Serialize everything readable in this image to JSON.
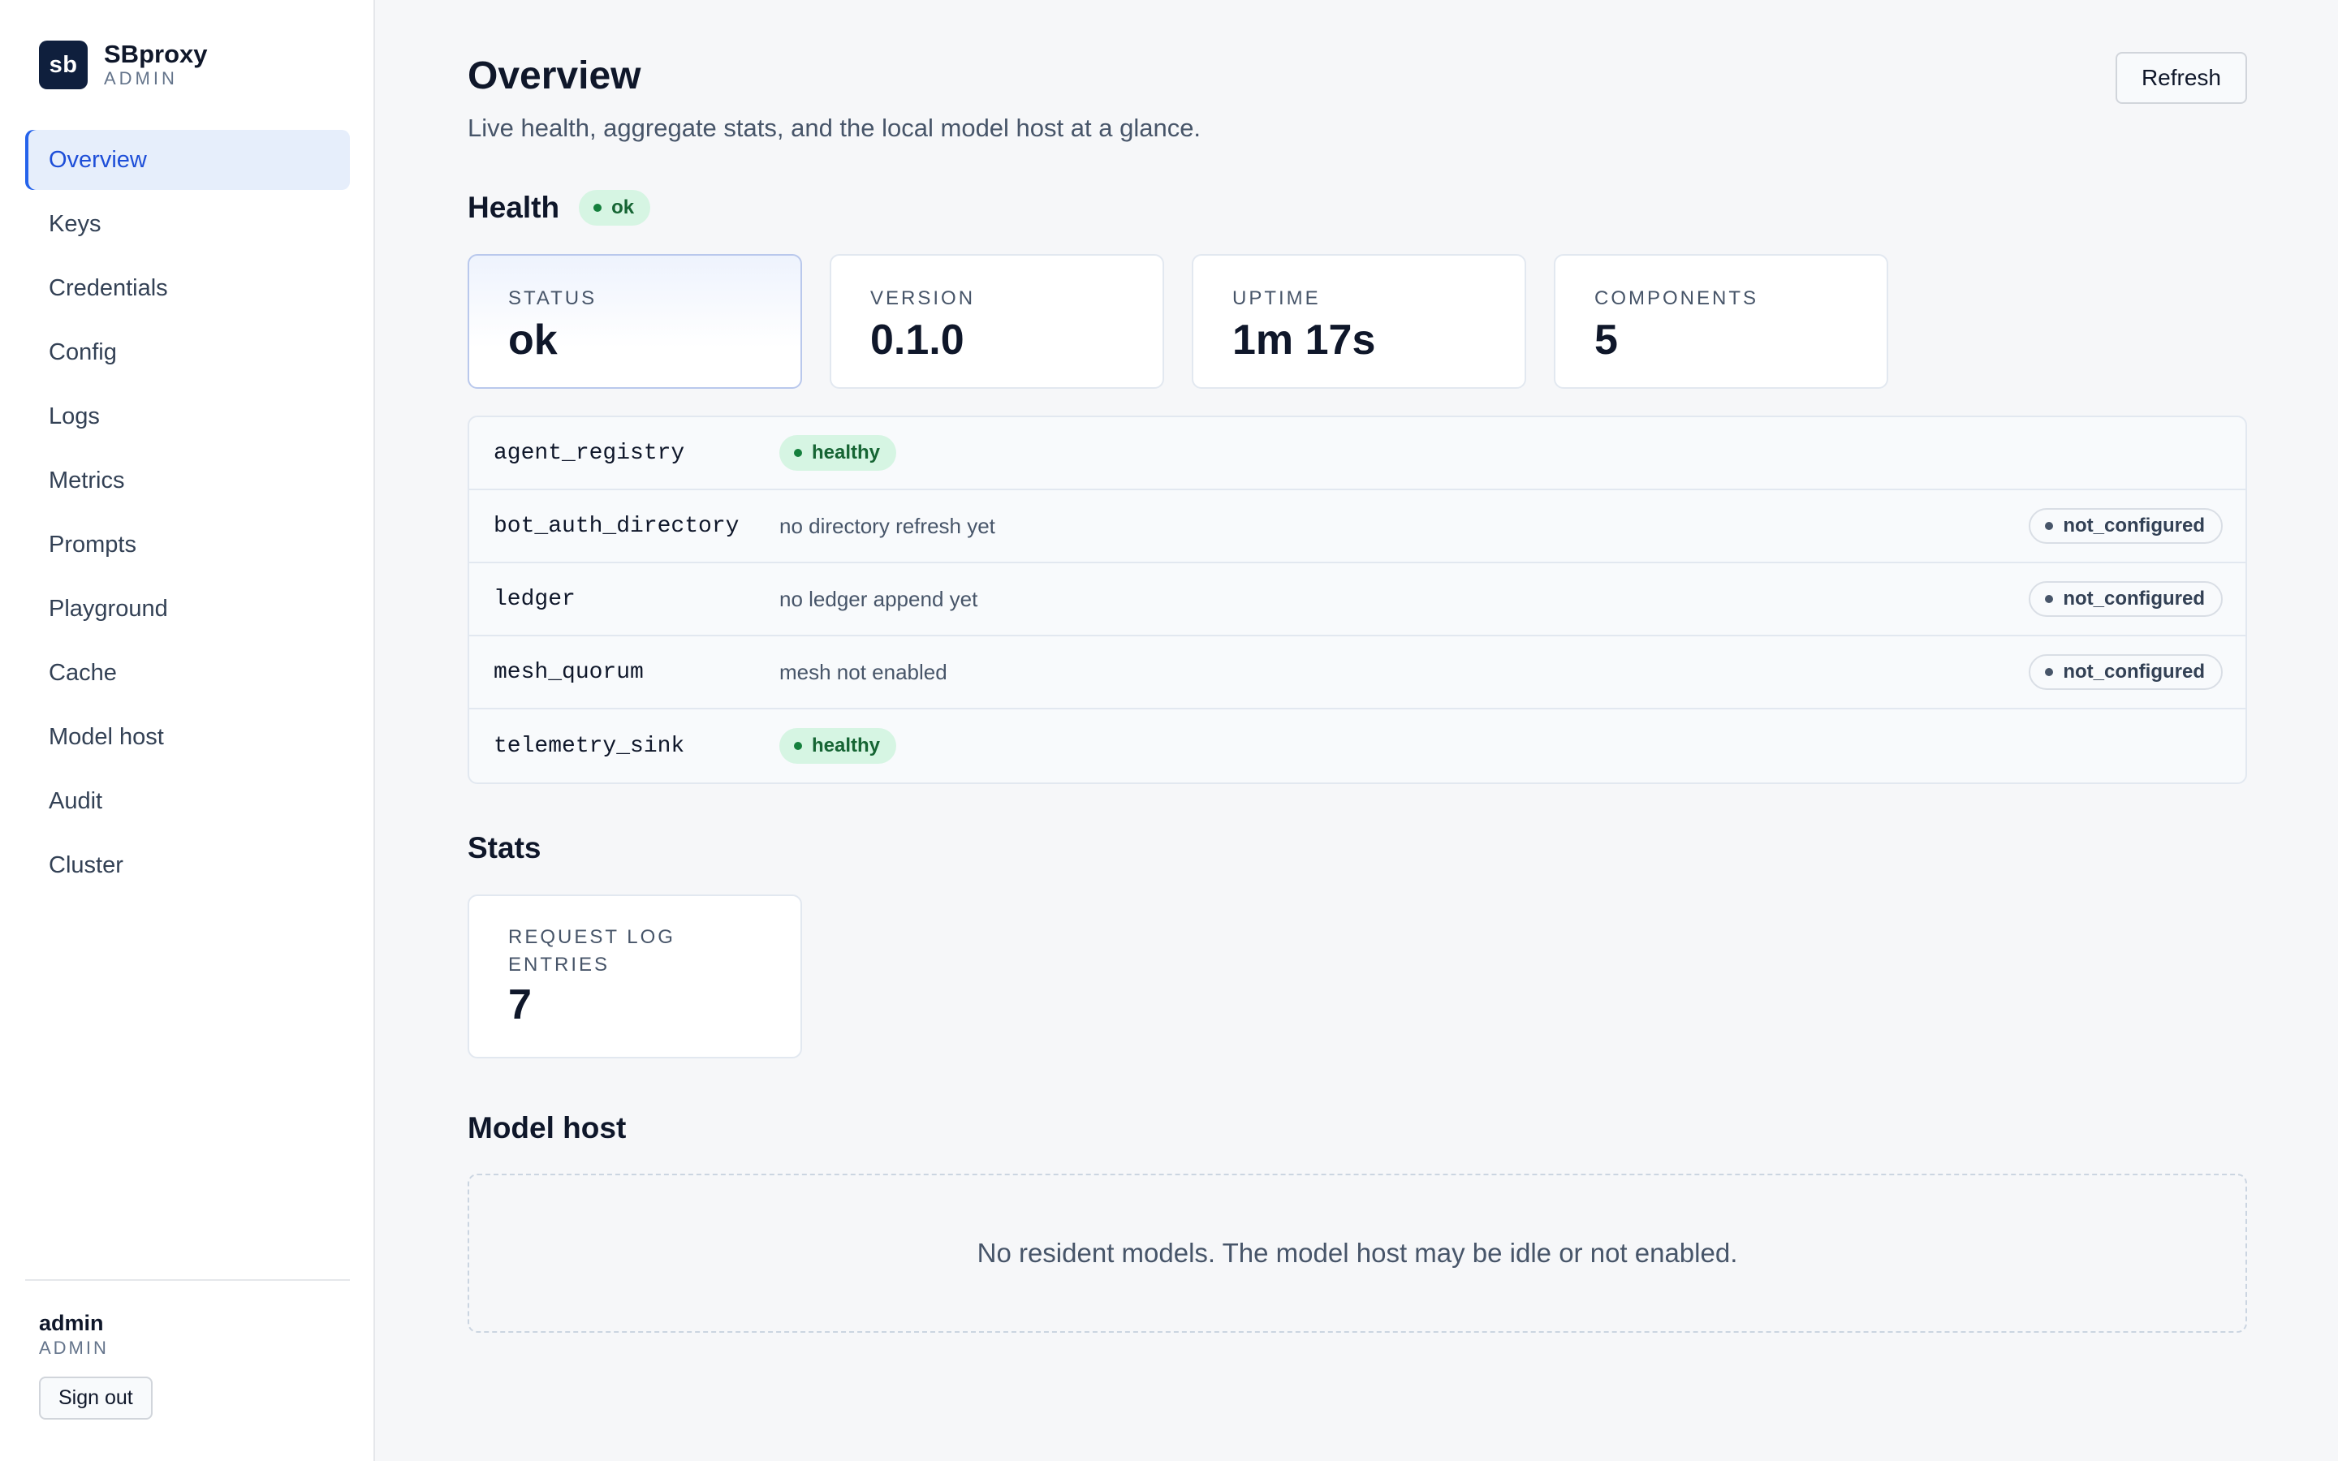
{
  "brand": {
    "logo_text": "sb",
    "name": "SBproxy",
    "role": "ADMIN"
  },
  "nav": {
    "items": [
      {
        "label": "Overview",
        "active": true
      },
      {
        "label": "Keys"
      },
      {
        "label": "Credentials"
      },
      {
        "label": "Config"
      },
      {
        "label": "Logs"
      },
      {
        "label": "Metrics"
      },
      {
        "label": "Prompts"
      },
      {
        "label": "Playground"
      },
      {
        "label": "Cache"
      },
      {
        "label": "Model host"
      },
      {
        "label": "Audit"
      },
      {
        "label": "Cluster"
      }
    ]
  },
  "user": {
    "name": "admin",
    "role": "ADMIN",
    "signout_label": "Sign out"
  },
  "page": {
    "title": "Overview",
    "subtitle": "Live health, aggregate stats, and the local model host at a glance.",
    "refresh_label": "Refresh"
  },
  "health": {
    "title": "Health",
    "status_pill": "ok",
    "cards": [
      {
        "label": "STATUS",
        "value": "ok"
      },
      {
        "label": "VERSION",
        "value": "0.1.0"
      },
      {
        "label": "UPTIME",
        "value": "1m 17s"
      },
      {
        "label": "COMPONENTS",
        "value": "5"
      }
    ],
    "components": [
      {
        "name": "agent_registry",
        "status": "healthy",
        "note": ""
      },
      {
        "name": "bot_auth_directory",
        "status": "not_configured",
        "note": "no directory refresh yet"
      },
      {
        "name": "ledger",
        "status": "not_configured",
        "note": "no ledger append yet"
      },
      {
        "name": "mesh_quorum",
        "status": "not_configured",
        "note": "mesh not enabled"
      },
      {
        "name": "telemetry_sink",
        "status": "healthy",
        "note": ""
      }
    ]
  },
  "stats": {
    "title": "Stats",
    "cards": [
      {
        "label": "REQUEST LOG ENTRIES",
        "value": "7"
      }
    ]
  },
  "model_host": {
    "title": "Model host",
    "empty_message": "No resident models. The model host may be idle or not enabled."
  },
  "colors": {
    "accent": "#2563eb",
    "brand_dark": "#0f1f3d",
    "healthy_bg": "#d6f5e3",
    "healthy_text": "#166534"
  }
}
